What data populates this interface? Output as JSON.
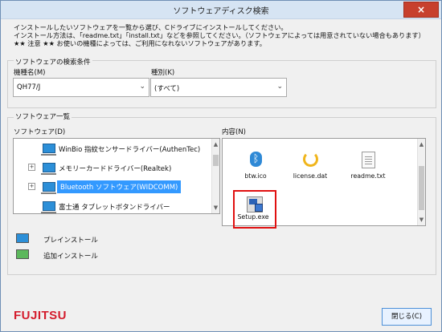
{
  "window": {
    "title": "ソフトウェアディスク検索"
  },
  "intro": {
    "line1": "インストールしたいソフトウェアを一覧から選び、Cドライブにインストールしてください。",
    "line2": "インストール方法は、「readme.txt」「install.txt」などを参照してください。（ソフトウェアによっては用意されていない場合もあります）",
    "line3": "★★ 注意 ★★ お使いの機種によっては、ご利用になれないソフトウェアがあります。"
  },
  "search_conditions": {
    "group_title": "ソフトウェアの検索条件",
    "model_label": "機種名(M)",
    "model_value": "QH77/J",
    "type_label": "種別(K)",
    "type_value": "(すべて)"
  },
  "software_list": {
    "group_title": "ソフトウェア一覧",
    "software_label": "ソフトウェア(D)",
    "contents_label": "内容(N)",
    "items": [
      "WinBio 指紋センサードライバー(AuthenTec)",
      "メモリーカードドライバー(Realtek)",
      "Bluetooth ソフトウェア(WIDCOMM)",
      "富士通 タブレットボタンドライバー"
    ],
    "files": [
      "btw.ico",
      "license.dat",
      "readme.txt",
      "Setup.exe"
    ]
  },
  "legend": {
    "preinstall": "プレインストール",
    "additional": "追加インストール"
  },
  "footer": {
    "brand": "FUJITSU",
    "close": "閉じる(C)"
  },
  "colors": {
    "selection": "#3399ff",
    "highlight": "#e01010",
    "brand": "#d41b2c"
  }
}
